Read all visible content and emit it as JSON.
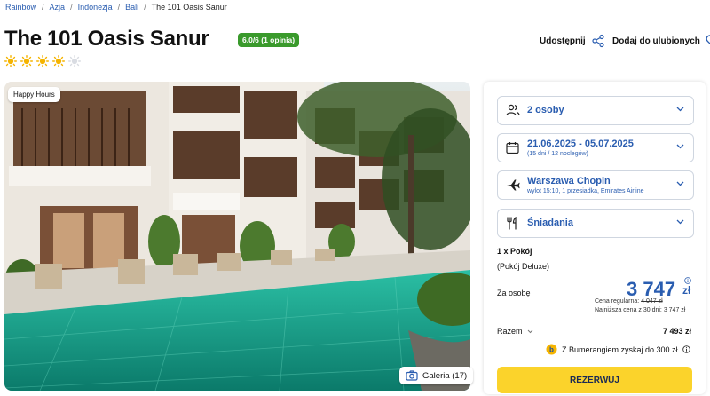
{
  "breadcrumb": [
    "Rainbow",
    "Azja",
    "Indonezja",
    "Bali",
    "The 101 Oasis Sanur"
  ],
  "hotel": {
    "name": "The 101 Oasis Sanur",
    "rating_label": "6.0/6 (1 opinia)",
    "category_stars": 4,
    "category_max": 5
  },
  "actions": {
    "share": "Udostępnij",
    "favorite": "Dodaj do ulubionych"
  },
  "gallery": {
    "badge": "Happy Hours",
    "button": "Galeria (17)"
  },
  "booking": {
    "guests": "2 osoby",
    "dates": "21.06.2025 - 05.07.2025",
    "dates_sub": "(15 dni / 12 noclegów)",
    "departure": "Warszawa Chopin",
    "departure_sub": "wylot 15:10, 1 przesiadka, Emirates Airline",
    "board": "Śniadania",
    "room_count": "1 x Pokój",
    "room_type": "(Pokój Deluxe)",
    "per_person_label": "Za osobę",
    "price_per_person": "3 747",
    "currency": "zł",
    "regular_label": "Cena regularna:",
    "regular_price": "4 047 zł",
    "lowest_label": "Najniższa cena z 30 dni: 3 747 zł",
    "total_label": "Razem",
    "total_price": "7 493 zł",
    "bumerang": "Z Bumerangiem zyskaj do 300 zł",
    "reserve": "REZERWUJ"
  },
  "colors": {
    "accent": "#2a5db0",
    "rating": "#3a9a2c",
    "reserve": "#fbd32b",
    "sun": "#f5b400"
  }
}
